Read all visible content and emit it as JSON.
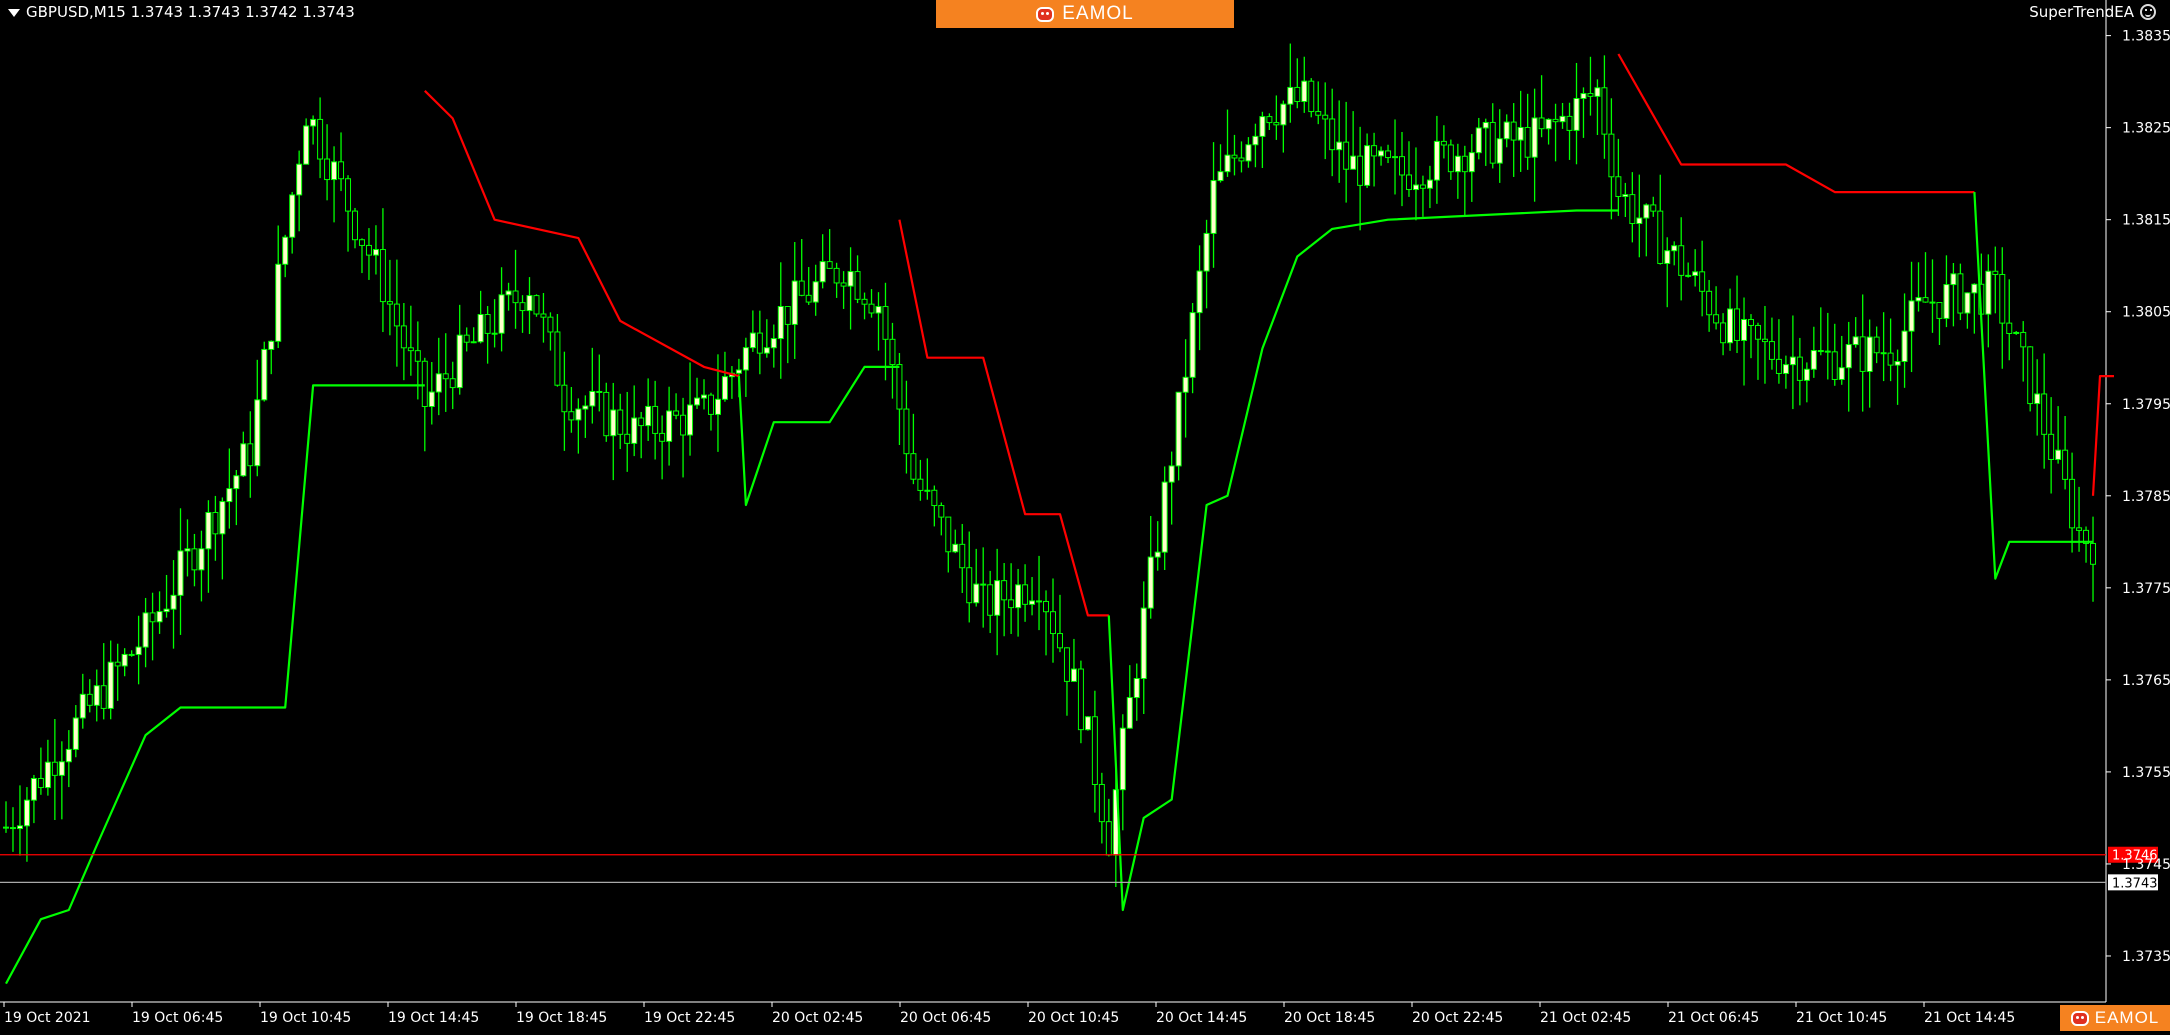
{
  "header": {
    "symbol_info": "GBPUSD,M15  1.3743 1.3743 1.3742 1.3743",
    "indicator_name": "SuperTrendEA"
  },
  "watermark": {
    "text": "EAMOL"
  },
  "colors": {
    "background": "#000000",
    "axis": "#ffffff",
    "bull_candle": "#ffffcc",
    "bear_candle": "#000000",
    "wick": "#00ff00",
    "supertrend_up": "#00ff00",
    "supertrend_down": "#ff0000",
    "bid_line": "#ff0000",
    "ask_line": "#a9a9a9"
  },
  "chart_data": {
    "type": "candlestick",
    "symbol": "GBPUSD",
    "timeframe": "M15",
    "ylim": [
      1.373,
      1.3838
    ],
    "y_ticks": [
      "1.3835",
      "1.3825",
      "1.3815",
      "1.3805",
      "1.3795",
      "1.3785",
      "1.3775",
      "1.3765",
      "1.3755",
      "1.3745",
      "1.3735"
    ],
    "x_ticks": [
      "19 Oct 2021",
      "19 Oct 06:45",
      "19 Oct 10:45",
      "19 Oct 14:45",
      "19 Oct 18:45",
      "19 Oct 22:45",
      "20 Oct 02:45",
      "20 Oct 06:45",
      "20 Oct 10:45",
      "20 Oct 14:45",
      "20 Oct 18:45",
      "20 Oct 22:45",
      "21 Oct 02:45",
      "21 Oct 06:45",
      "21 Oct 10:45",
      "21 Oct 14:45"
    ],
    "price_lines": [
      {
        "name": "bid",
        "value": 1.3746,
        "label": "1.3746"
      },
      {
        "name": "ask",
        "value": 1.3743,
        "label": "1.3743"
      }
    ],
    "candle_count": 300,
    "close_path": [
      [
        0,
        1.3749
      ],
      [
        8,
        1.3758
      ],
      [
        20,
        1.377
      ],
      [
        35,
        1.379
      ],
      [
        43,
        1.3827
      ],
      [
        54,
        1.3808
      ],
      [
        60,
        1.3795
      ],
      [
        65,
        1.38
      ],
      [
        75,
        1.3808
      ],
      [
        80,
        1.3796
      ],
      [
        90,
        1.3792
      ],
      [
        100,
        1.3794
      ],
      [
        108,
        1.3803
      ],
      [
        115,
        1.3807
      ],
      [
        120,
        1.381
      ],
      [
        125,
        1.3806
      ],
      [
        130,
        1.3787
      ],
      [
        140,
        1.3773
      ],
      [
        148,
        1.3776
      ],
      [
        154,
        1.3762
      ],
      [
        158,
        1.3748
      ],
      [
        162,
        1.3767
      ],
      [
        168,
        1.3794
      ],
      [
        173,
        1.3818
      ],
      [
        180,
        1.3827
      ],
      [
        186,
        1.3828
      ],
      [
        192,
        1.3821
      ],
      [
        200,
        1.382
      ],
      [
        210,
        1.3823
      ],
      [
        220,
        1.3824
      ],
      [
        228,
        1.3829
      ],
      [
        231,
        1.3818
      ],
      [
        240,
        1.381
      ],
      [
        248,
        1.3802
      ],
      [
        255,
        1.38
      ],
      [
        262,
        1.38
      ],
      [
        270,
        1.3801
      ],
      [
        275,
        1.3806
      ],
      [
        280,
        1.3807
      ],
      [
        285,
        1.3807
      ],
      [
        290,
        1.3797
      ],
      [
        297,
        1.3781
      ],
      [
        299,
        1.378
      ]
    ],
    "supertrend_segments": [
      {
        "direction": "up",
        "points": [
          [
            0,
            1.3732
          ],
          [
            5,
            1.3739
          ],
          [
            9,
            1.374
          ],
          [
            13,
            1.3747
          ],
          [
            20,
            1.3759
          ],
          [
            25,
            1.3762
          ],
          [
            40,
            1.3762
          ],
          [
            44,
            1.3797
          ],
          [
            60,
            1.3797
          ]
        ]
      },
      {
        "direction": "down",
        "points": [
          [
            60,
            1.3829
          ],
          [
            64,
            1.3826
          ],
          [
            70,
            1.3815
          ],
          [
            82,
            1.3813
          ],
          [
            88,
            1.3804
          ],
          [
            100,
            1.3799
          ],
          [
            105,
            1.3798
          ]
        ]
      },
      {
        "direction": "up",
        "points": [
          [
            105,
            1.3798
          ],
          [
            106,
            1.3784
          ],
          [
            110,
            1.3793
          ],
          [
            118,
            1.3793
          ],
          [
            123,
            1.3799
          ],
          [
            128,
            1.3799
          ]
        ]
      },
      {
        "direction": "down",
        "points": [
          [
            128,
            1.3815
          ],
          [
            132,
            1.38
          ],
          [
            140,
            1.38
          ],
          [
            146,
            1.3783
          ],
          [
            151,
            1.3783
          ],
          [
            155,
            1.3772
          ],
          [
            158,
            1.3772
          ]
        ]
      },
      {
        "direction": "up",
        "points": [
          [
            158,
            1.3772
          ],
          [
            160,
            1.374
          ],
          [
            163,
            1.375
          ],
          [
            167,
            1.3752
          ],
          [
            172,
            1.3784
          ],
          [
            175,
            1.3785
          ],
          [
            180,
            1.3801
          ],
          [
            185,
            1.3811
          ],
          [
            190,
            1.3814
          ],
          [
            198,
            1.3815
          ],
          [
            225,
            1.3816
          ],
          [
            231,
            1.3816
          ]
        ]
      },
      {
        "direction": "down",
        "points": [
          [
            231,
            1.3833
          ],
          [
            240,
            1.3821
          ],
          [
            255,
            1.3821
          ],
          [
            262,
            1.3818
          ],
          [
            278,
            1.3818
          ],
          [
            282,
            1.3818
          ]
        ]
      },
      {
        "direction": "up",
        "points": [
          [
            282,
            1.3818
          ],
          [
            285,
            1.3776
          ],
          [
            287,
            1.378
          ],
          [
            299,
            1.378
          ]
        ]
      },
      {
        "direction": "down",
        "points": [
          [
            299,
            1.3785
          ],
          [
            300,
            1.3798
          ],
          [
            302,
            1.3798
          ]
        ]
      }
    ]
  }
}
